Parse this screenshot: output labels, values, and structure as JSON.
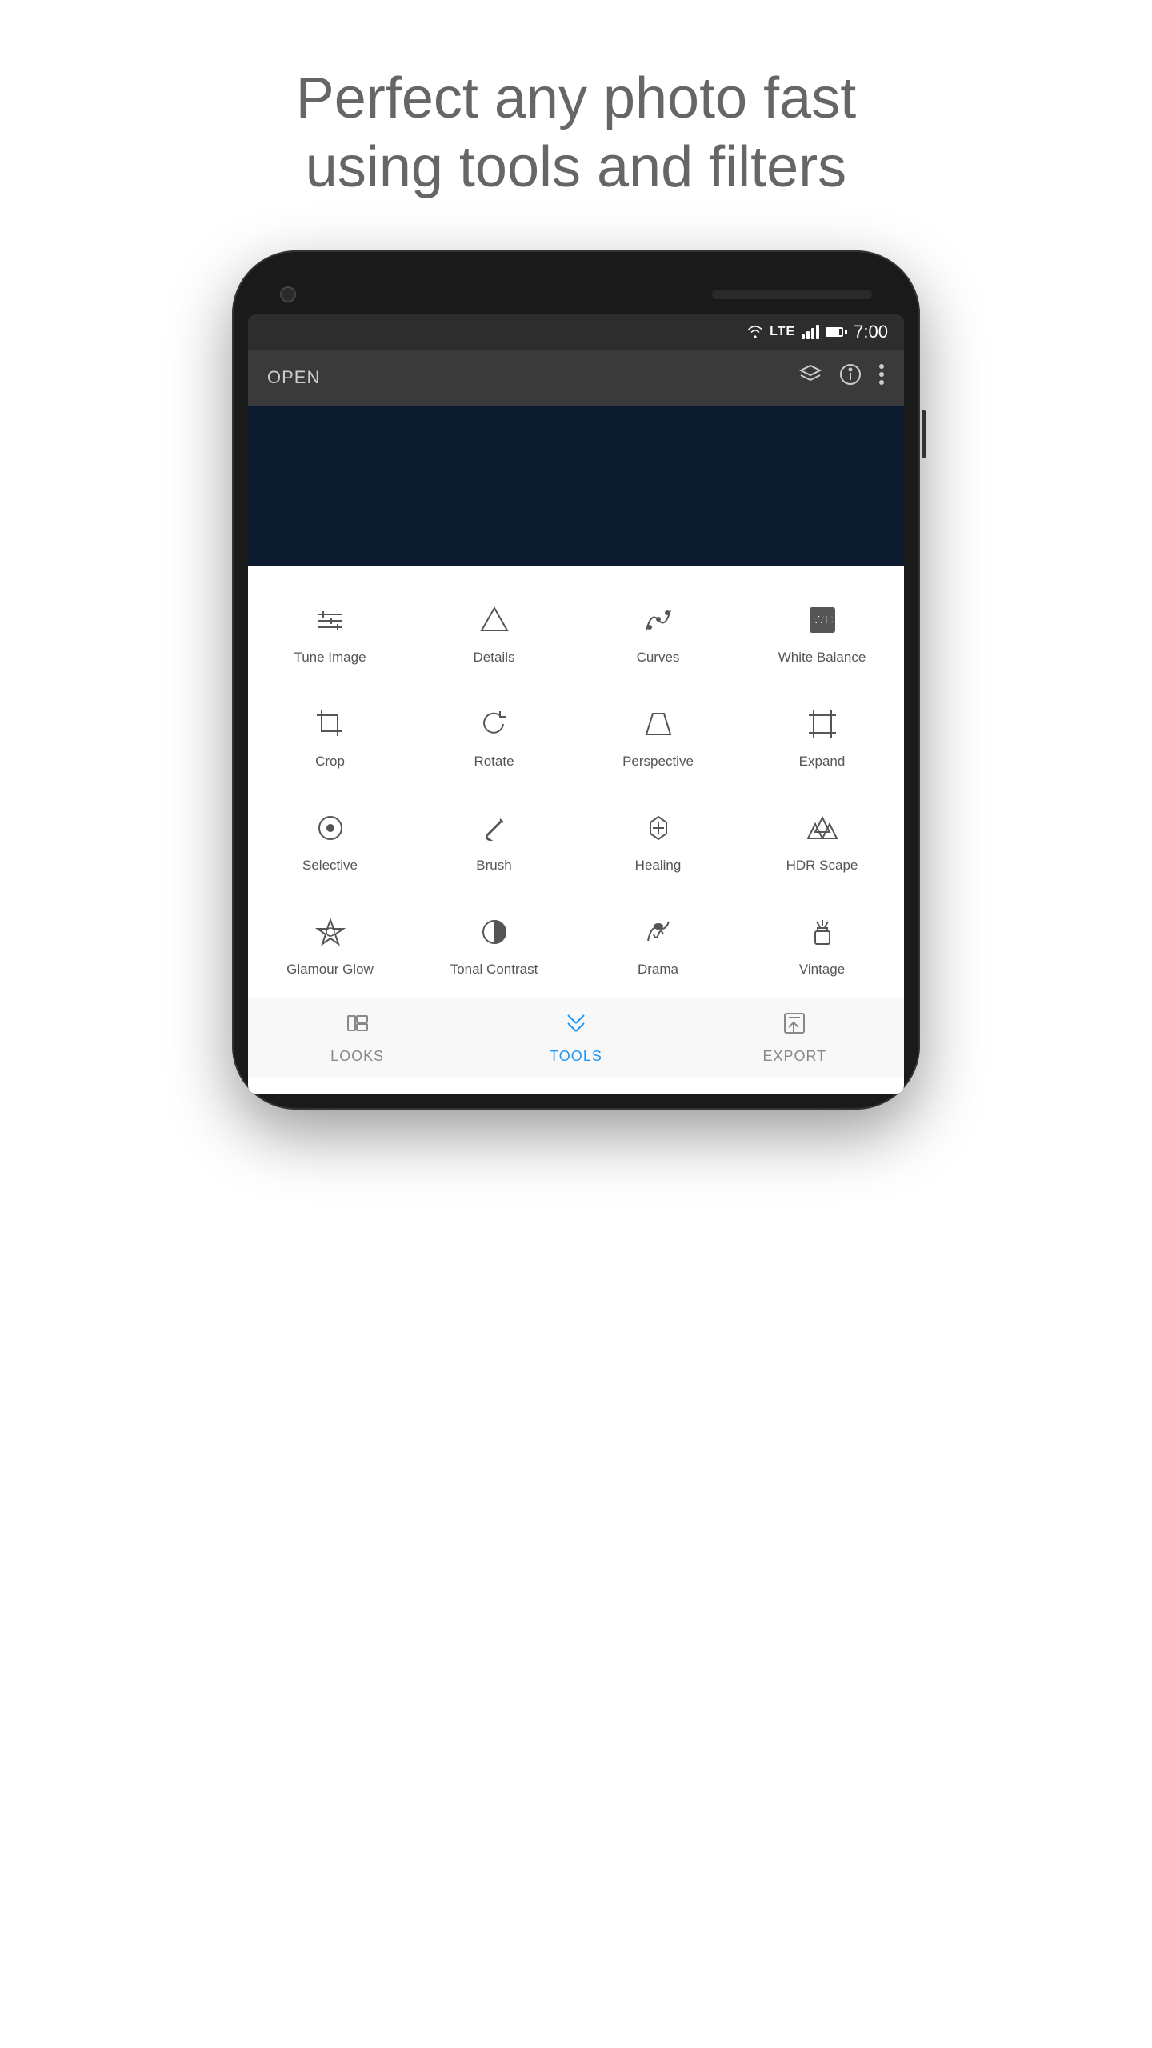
{
  "headline": {
    "line1": "Perfect any photo fast",
    "line2": "using tools and filters"
  },
  "statusBar": {
    "time": "7:00",
    "lte": "LTE"
  },
  "toolbar": {
    "open_label": "OPEN"
  },
  "tools": [
    {
      "id": "tune-image",
      "label": "Tune Image",
      "icon": "tune"
    },
    {
      "id": "details",
      "label": "Details",
      "icon": "details"
    },
    {
      "id": "curves",
      "label": "Curves",
      "icon": "curves"
    },
    {
      "id": "white-balance",
      "label": "White Balance",
      "icon": "wb"
    },
    {
      "id": "crop",
      "label": "Crop",
      "icon": "crop"
    },
    {
      "id": "rotate",
      "label": "Rotate",
      "icon": "rotate"
    },
    {
      "id": "perspective",
      "label": "Perspective",
      "icon": "perspective"
    },
    {
      "id": "expand",
      "label": "Expand",
      "icon": "expand"
    },
    {
      "id": "selective",
      "label": "Selective",
      "icon": "selective"
    },
    {
      "id": "brush",
      "label": "Brush",
      "icon": "brush"
    },
    {
      "id": "healing",
      "label": "Healing",
      "icon": "healing"
    },
    {
      "id": "hdr-scape",
      "label": "HDR Scape",
      "icon": "hdr"
    },
    {
      "id": "glamour-glow",
      "label": "Glamour Glow",
      "icon": "glamour"
    },
    {
      "id": "tonal-contrast",
      "label": "Tonal Contrast",
      "icon": "tonal"
    },
    {
      "id": "drama",
      "label": "Drama",
      "icon": "drama"
    },
    {
      "id": "vintage",
      "label": "Vintage",
      "icon": "vintage"
    }
  ],
  "bottomNav": [
    {
      "id": "looks",
      "label": "LOOKS",
      "active": false,
      "icon": "looks"
    },
    {
      "id": "tools",
      "label": "TOOLS",
      "active": true,
      "icon": "tools"
    },
    {
      "id": "export",
      "label": "EXPORT",
      "active": false,
      "icon": "export"
    }
  ]
}
